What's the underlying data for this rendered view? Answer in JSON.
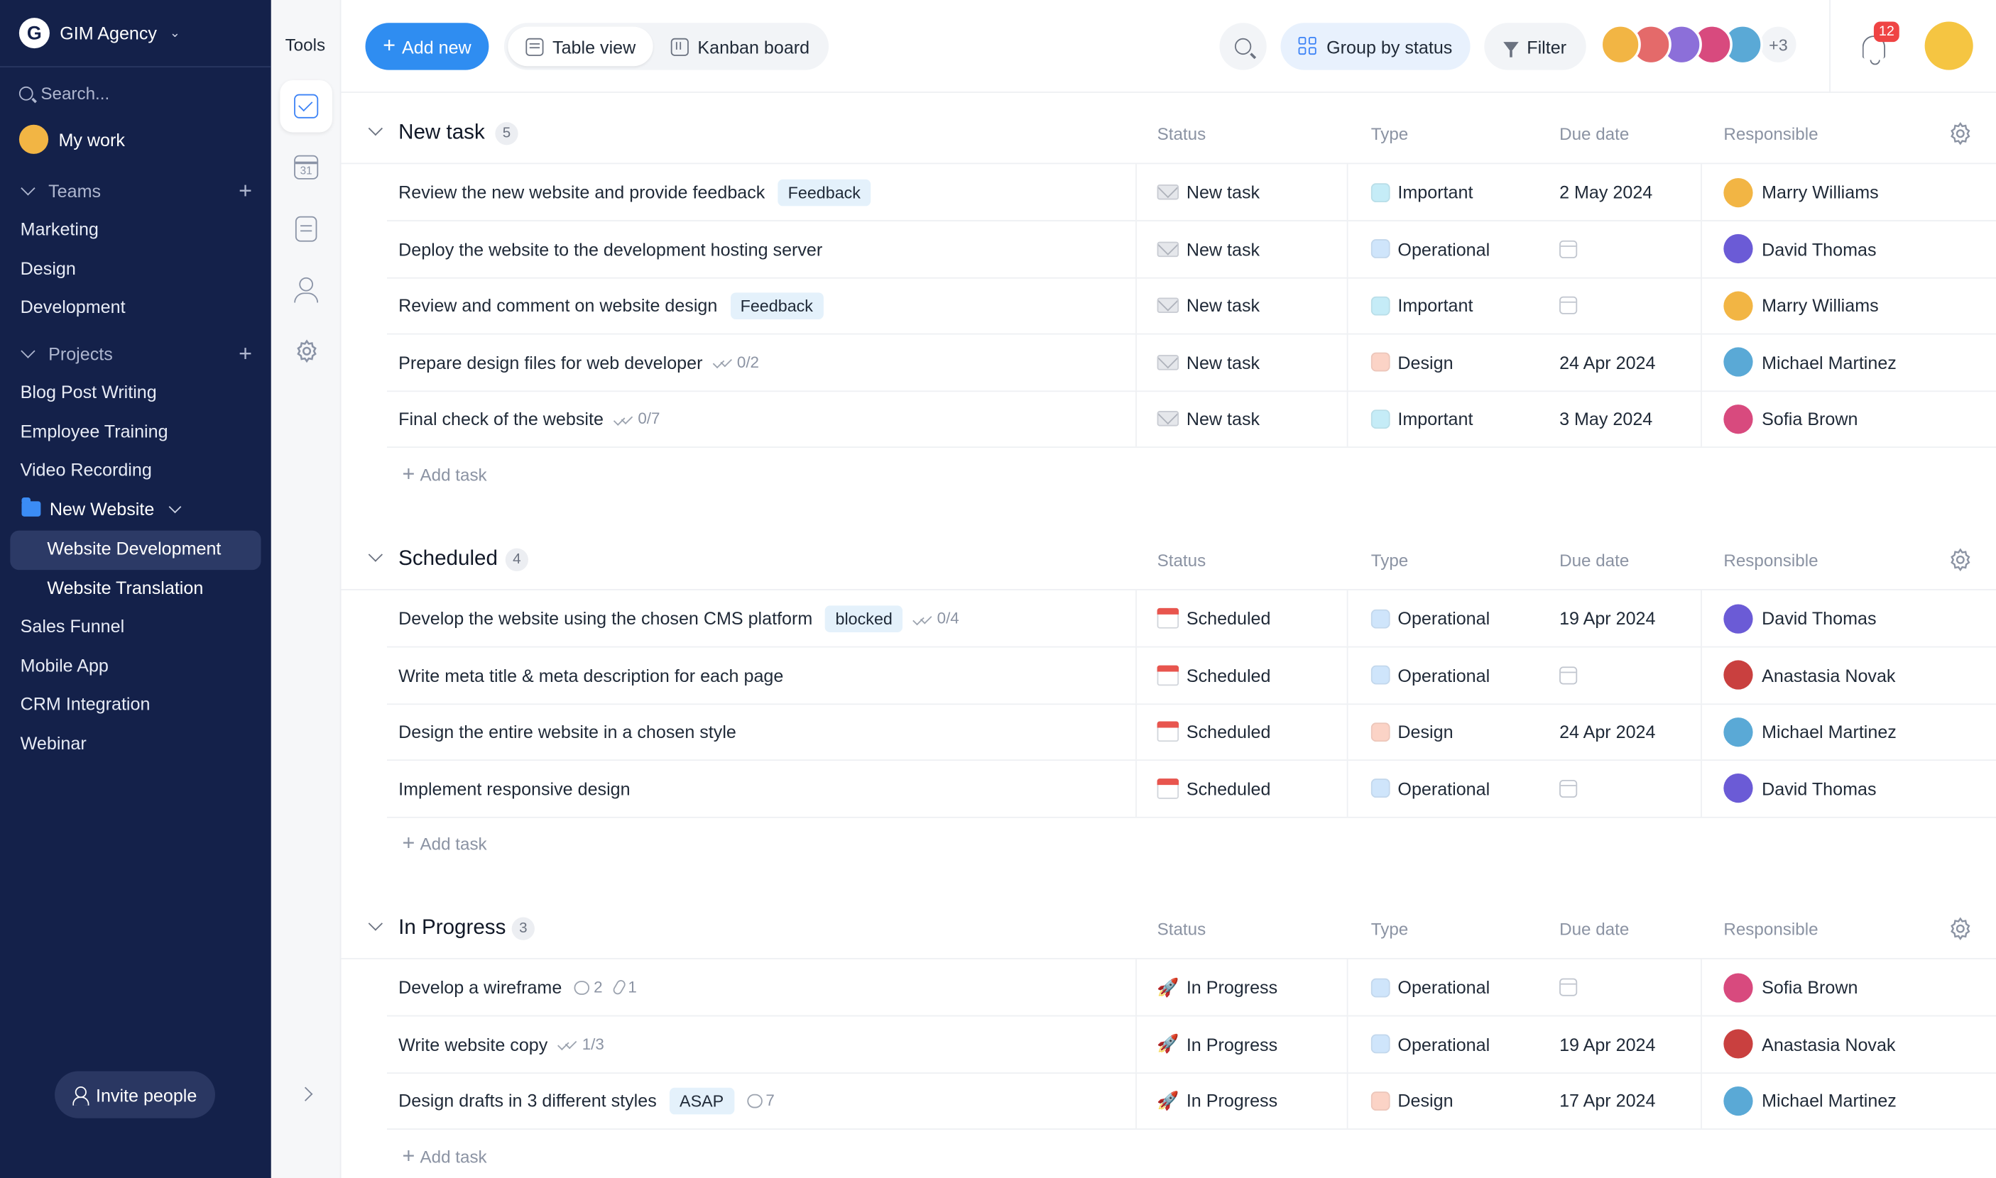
{
  "workspace": {
    "name": "GIM Agency",
    "logo_letter": "G"
  },
  "sidebar": {
    "search_placeholder": "Search...",
    "my_work": "My work",
    "teams_label": "Teams",
    "teams": [
      "Marketing",
      "Design",
      "Development"
    ],
    "projects_label": "Projects",
    "projects_top": [
      "Blog Post Writing",
      "Employee Training",
      "Video Recording"
    ],
    "folder": {
      "label": "New Website",
      "children": [
        "Website Development",
        "Website Translation"
      ],
      "active": "Website Development"
    },
    "projects_bottom": [
      "Sales Funnel",
      "Mobile App",
      "CRM Integration",
      "Webinar"
    ],
    "invite_label": "Invite people"
  },
  "tools": {
    "title": "Tools",
    "calendar_day": "31"
  },
  "toolbar": {
    "add_new": "Add new",
    "view_tabs": [
      {
        "label": "Table view",
        "active": true
      },
      {
        "label": "Kanban board",
        "active": false
      }
    ],
    "group_by": "Group by status",
    "filter": "Filter",
    "members_more": "+3",
    "notifications_count": "12"
  },
  "columns": {
    "status": "Status",
    "type": "Type",
    "due": "Due date",
    "responsible": "Responsible"
  },
  "add_task_label": "Add task",
  "groups": [
    {
      "title": "New task",
      "count": "5",
      "tasks": [
        {
          "name": "Review the new website and provide feedback",
          "tag": "Feedback",
          "status": "New task",
          "type": "Important",
          "due": "2 May 2024",
          "responsible": "Marry Williams"
        },
        {
          "name": "Deploy the website to the development hosting server",
          "status": "New task",
          "type": "Operational",
          "due": "",
          "responsible": "David Thomas"
        },
        {
          "name": "Review and comment on website design",
          "tag": "Feedback",
          "status": "New task",
          "type": "Important",
          "due": "",
          "responsible": "Marry Williams"
        },
        {
          "name": "Prepare design files for web developer",
          "checklist": "0/2",
          "status": "New task",
          "type": "Design",
          "due": "24 Apr 2024",
          "responsible": "Michael Martinez"
        },
        {
          "name": "Final check of the website",
          "checklist": "0/7",
          "status": "New task",
          "type": "Important",
          "due": "3 May 2024",
          "responsible": "Sofia Brown"
        }
      ]
    },
    {
      "title": "Scheduled",
      "count": "4",
      "tasks": [
        {
          "name": "Develop the website using the chosen CMS platform",
          "tag": "blocked",
          "checklist": "0/4",
          "status": "Scheduled",
          "type": "Operational",
          "due": "19 Apr 2024",
          "responsible": "David Thomas"
        },
        {
          "name": "Write meta title & meta description for each page",
          "status": "Scheduled",
          "type": "Operational",
          "due": "",
          "responsible": "Anastasia Novak"
        },
        {
          "name": "Design the entire website in a chosen style",
          "status": "Scheduled",
          "type": "Design",
          "due": "24 Apr 2024",
          "responsible": "Michael Martinez"
        },
        {
          "name": "Implement responsive design",
          "status": "Scheduled",
          "type": "Operational",
          "due": "",
          "responsible": "David Thomas"
        }
      ]
    },
    {
      "title": "In Progress",
      "count": "3",
      "tasks": [
        {
          "name": "Develop a wireframe",
          "comments": "2",
          "attachments": "1",
          "status": "In Progress",
          "type": "Operational",
          "due": "",
          "responsible": "Sofia Brown"
        },
        {
          "name": "Write website copy",
          "checklist": "1/3",
          "status": "In Progress",
          "type": "Operational",
          "due": "19 Apr 2024",
          "responsible": "Anastasia Novak"
        },
        {
          "name": "Design drafts in 3 different styles",
          "tag": "ASAP",
          "comments": "7",
          "status": "In Progress",
          "type": "Design",
          "due": "17 Apr 2024",
          "responsible": "Michael Martinez"
        }
      ]
    }
  ],
  "colors": {
    "sidebar_bg": "#14214a",
    "accent": "#2f8df1",
    "type_important": "#c5ecf7",
    "type_operational": "#cfe5fb",
    "type_design": "#fbd3c6",
    "badge_red": "#ef4444"
  },
  "people_colors": {
    "Marry Williams": "#f2b544",
    "David Thomas": "#6b5bd6",
    "Michael Martinez": "#5aa9d6",
    "Sofia Brown": "#d84a7e",
    "Anastasia Novak": "#c9403f"
  },
  "member_avatar_colors": [
    "#f2b544",
    "#e46a6a",
    "#8c6fd9",
    "#d84a7e",
    "#5aa9d6"
  ]
}
